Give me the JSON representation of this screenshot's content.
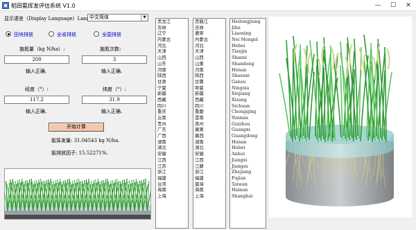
{
  "window": {
    "title": "稻田氨挥发评估系统 V1.0",
    "min": "—",
    "max": "☐",
    "close": "✕"
  },
  "lang": {
    "label": "显示语言（Display Language）Language:",
    "value": "中文简体"
  },
  "scope": {
    "options": [
      "田块排放",
      "全省排放",
      "全国排放"
    ],
    "selected": 0
  },
  "n_rate": {
    "label": "施氮量（kg N/ha）:",
    "value": "200",
    "status": "输入正确."
  },
  "n_times": {
    "label": "施氮次数:",
    "value": "3",
    "status": "输入正确."
  },
  "longitude": {
    "label": "经度（°）:",
    "value": "117.2",
    "status": "输入正确."
  },
  "latitude": {
    "label": "纬度（°）:",
    "value": "31.9",
    "status": "输入正确."
  },
  "calc_button": "开始计算",
  "result": {
    "amount": "氨挥发量: 31.04543 kg N/ha.",
    "factor": "氨排放因子: 15.52271%."
  },
  "provinces_trad": [
    "黑龙江",
    "吉林",
    "辽宁",
    "内蒙古",
    "河北",
    "天津",
    "山西",
    "山东",
    "河南",
    "陕西",
    "甘肃",
    "宁夏",
    "新疆",
    "西藏",
    "四川",
    "重庆",
    "云南",
    "贵州",
    "广东",
    "广西",
    "湖南",
    "湖北",
    "安徽",
    "江西",
    "江苏",
    "浙江",
    "福建",
    "台湾",
    "海南",
    "上海"
  ],
  "provinces_simp": [
    "黑龍江",
    "吉林",
    "遼寧",
    "內蒙古",
    "河北",
    "天津",
    "山西",
    "山東",
    "河南",
    "陝西",
    "甘肅",
    "寧夏",
    "新疆",
    "西藏",
    "四川",
    "重慶",
    "雲南",
    "貴州",
    "廣東",
    "廣西",
    "湖南",
    "湖北",
    "安徽",
    "江西",
    "江蘇",
    "浙江",
    "福建",
    "臺灣",
    "海南",
    "上海"
  ],
  "provinces_en": [
    "Heilongjiang",
    "Jilin",
    "Liaoning",
    "Nei Mongol",
    "Hebei",
    "Tianjin",
    "Shanxi",
    "Shandong",
    "Henan",
    "Shaanxi",
    "Gansu",
    "Ningxia",
    "Xinjiang",
    "Xizang",
    "Sichuan",
    "Chongqing",
    "Yunnan",
    "Guizhou",
    "Guangxi",
    "Guangdong",
    "Hunan",
    "Hubei",
    "Anhui",
    "Jiangxi",
    "Jiangsu",
    "Zhejiang",
    "Fujian",
    "Taiwan",
    "Hainan",
    "Shanghai"
  ]
}
